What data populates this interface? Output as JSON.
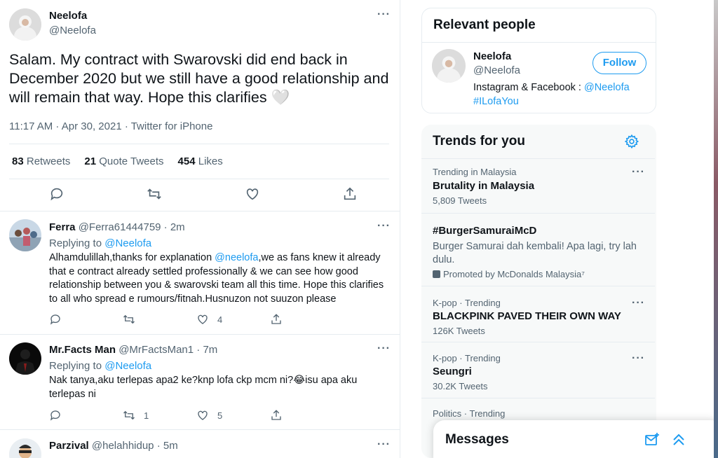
{
  "main_tweet": {
    "name": "Neelofa",
    "handle": "@Neelofa",
    "text": "Salam. My contract with Swarovski did end back in December 2020 but we still have a good relationship and will remain that way. Hope this clarifies 🤍",
    "meta": "11:17 AM · Apr 30, 2021 · Twitter for iPhone",
    "retweets_count": "83",
    "retweets_label": "Retweets",
    "quotes_count": "21",
    "quotes_label": "Quote Tweets",
    "likes_count": "454",
    "likes_label": "Likes"
  },
  "replies": [
    {
      "name": "Ferra",
      "handle": "@Ferra61444759 · 2m",
      "replying_prefix": "Replying to",
      "replying_to": "@Neelofa",
      "text_before": "Alhamdulillah,thanks for explanation ",
      "text_mention": "@neelofa",
      "text_after": ",we as fans knew it already that e contract already settled professionally & we can see how good relationship between you & swarovski team all this time. Hope this clarifies to all who spread e rumours/fitnah.Husnuzon not suuzon please",
      "retweets": "",
      "likes": "4"
    },
    {
      "name": "Mr.Facts Man",
      "handle": "@MrFactsMan1 · 7m",
      "replying_prefix": "Replying to",
      "replying_to": "@Neelofa",
      "text": "Nak tanya,aku terlepas apa2 ke?knp lofa ckp mcm ni?😂isu apa aku terlepas ni",
      "retweets": "1",
      "likes": "5"
    },
    {
      "name": "Parzival",
      "handle": "@helahhidup · 5m"
    }
  ],
  "relevant_people": {
    "title": "Relevant people",
    "name": "Neelofa",
    "handle": "@Neelofa",
    "follow_label": "Follow",
    "bio_prefix": "Instagram & Facebook : ",
    "bio_mention": "@Neelofa",
    "bio_hashtag": "#ILofaYou"
  },
  "trends": {
    "title": "Trends for you",
    "items": [
      {
        "context": "Trending in Malaysia",
        "name": "Brutality in Malaysia",
        "count": "5,809 Tweets"
      },
      {
        "context": "",
        "name": "#BurgerSamuraiMcD",
        "description": "Burger Samurai dah kembali! Apa lagi, try lah dulu.",
        "promoted": "Promoted by McDonalds Malaysia⁷"
      },
      {
        "context": "K-pop · Trending",
        "name": "BLACKPINK PAVED THEIR OWN WAY",
        "count": "126K Tweets"
      },
      {
        "context": "K-pop · Trending",
        "name": "Seungri",
        "count": "30.2K Tweets"
      },
      {
        "context": "Politics · Trending",
        "name": "",
        "count": ""
      }
    ]
  },
  "messages": {
    "title": "Messages"
  },
  "colors": {
    "accent": "#1d9bf0",
    "muted": "#536471",
    "text": "#0f1419",
    "border": "#e6ecf0"
  }
}
